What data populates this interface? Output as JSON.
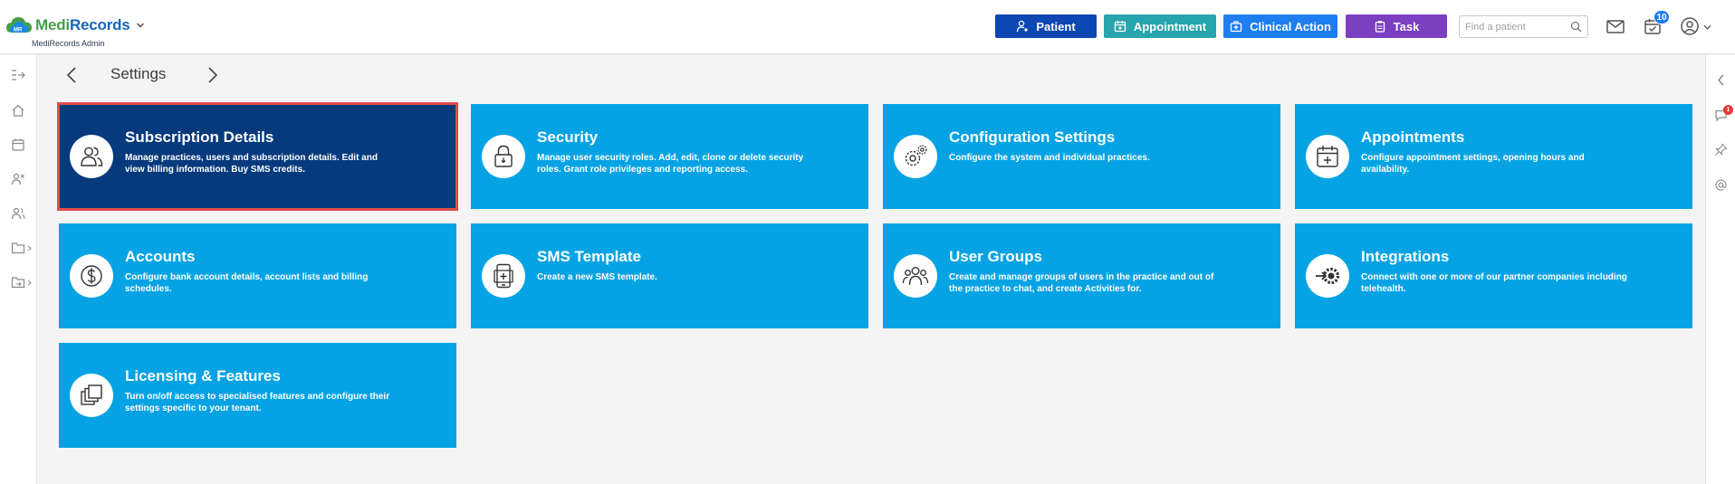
{
  "app": {
    "logo_part1": "Medi",
    "logo_part2": "Records",
    "subtitle": "MediRecords Admin"
  },
  "toolbar": {
    "patient_label": "Patient",
    "appointment_label": "Appointment",
    "clinical_label": "Clinical Action",
    "task_label": "Task",
    "search_placeholder": "Find a patient",
    "tasks_badge": "10"
  },
  "right_rail": {
    "chat_badge": "1"
  },
  "page": {
    "title": "Settings"
  },
  "tiles": [
    {
      "title": "Subscription Details",
      "desc": "Manage practices, users and subscription details. Edit and view billing information. Buy SMS credits."
    },
    {
      "title": "Security",
      "desc": "Manage user security roles. Add, edit, clone or delete security roles. Grant role privileges and reporting access."
    },
    {
      "title": "Configuration Settings",
      "desc": "Configure the system and individual practices."
    },
    {
      "title": "Appointments",
      "desc": "Configure appointment settings, opening hours and availability."
    },
    {
      "title": "Accounts",
      "desc": "Configure bank account details, account lists and billing schedules."
    },
    {
      "title": "SMS Template",
      "desc": "Create a new SMS template."
    },
    {
      "title": "User Groups",
      "desc": "Create and manage groups of users in the practice and out of the practice to chat, and create Activities for."
    },
    {
      "title": "Integrations",
      "desc": "Connect with one or more of our partner companies including telehealth."
    },
    {
      "title": "Licensing & Features",
      "desc": "Turn on/off access to specialised features and configure their settings specific to your tenant."
    }
  ],
  "colors": {
    "tile": "#06a3e4",
    "tile_active": "#063a7c",
    "active_outline": "#e14b4b",
    "patient_btn": "#0d47b3",
    "appointment_btn": "#27a5ac",
    "clinical_btn": "#1e7ef0",
    "task_btn": "#7b3fc1"
  }
}
